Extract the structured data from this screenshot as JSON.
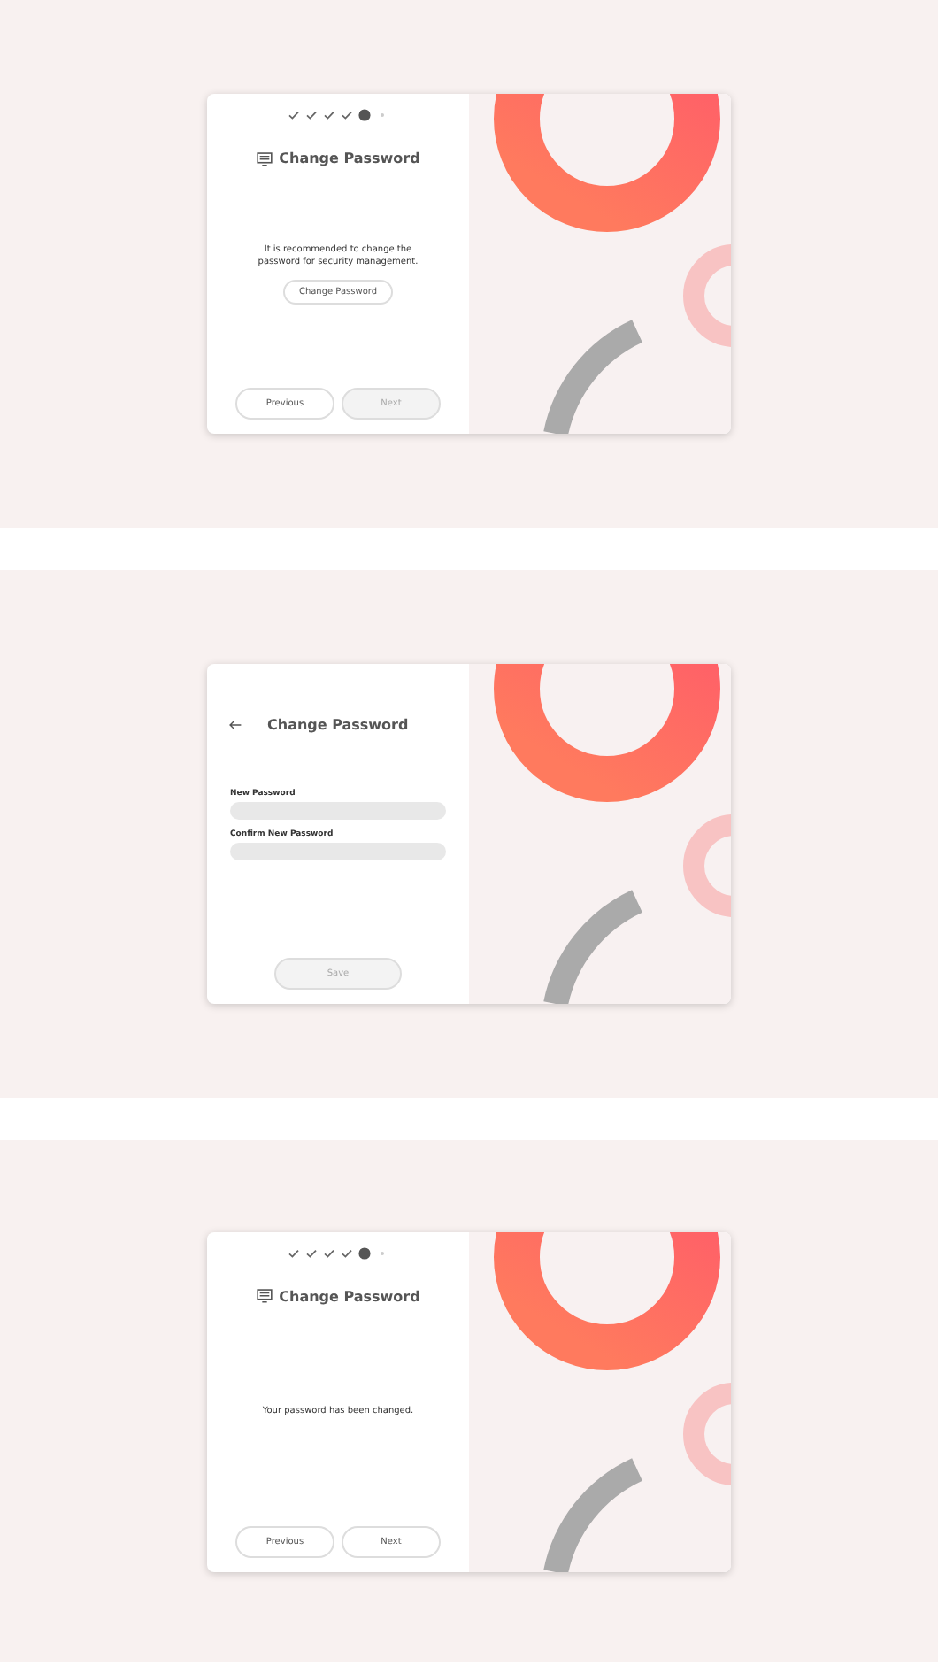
{
  "screens": [
    {
      "kind": "intro",
      "steps": [
        {
          "done": true
        },
        {
          "done": true
        },
        {
          "done": true
        },
        {
          "done": true
        },
        {
          "done": false,
          "current": true
        },
        {
          "done": false,
          "current": false
        }
      ],
      "title": "Change Password",
      "message": "It is recommended to change the password for security management.",
      "action": "Change Password",
      "buttons": [
        {
          "label": "Previous",
          "disabled": false
        },
        {
          "label": "Next",
          "disabled": true
        }
      ]
    },
    {
      "kind": "form",
      "title": "Change Password",
      "fields": [
        {
          "label": "New Password"
        },
        {
          "label": "Confirm New Password"
        }
      ],
      "buttons": [
        {
          "label": "Save",
          "disabled": true
        }
      ]
    },
    {
      "kind": "done",
      "steps": [
        {
          "done": true
        },
        {
          "done": true
        },
        {
          "done": true
        },
        {
          "done": true
        },
        {
          "done": false,
          "current": true
        },
        {
          "done": false,
          "current": false
        }
      ],
      "title": "Change Password",
      "message": "Your password has been changed.",
      "buttons": [
        {
          "label": "Previous",
          "disabled": false
        },
        {
          "label": "Next",
          "disabled": false
        }
      ]
    }
  ]
}
